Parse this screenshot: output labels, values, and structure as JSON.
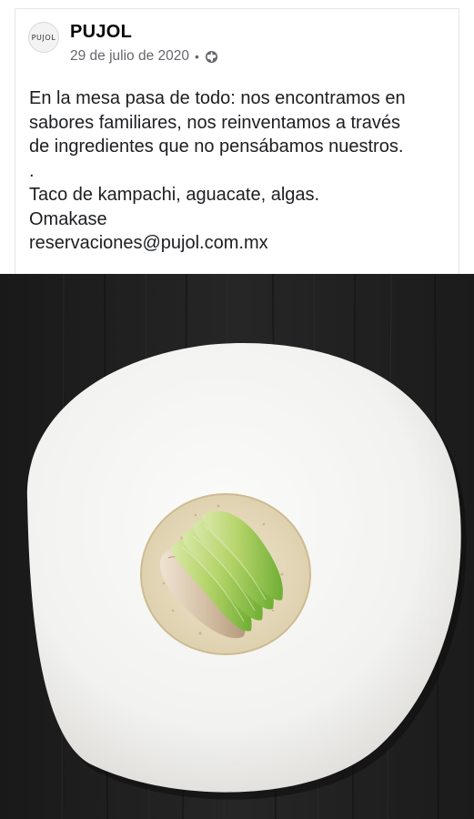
{
  "post": {
    "avatar_text": "PUJOL",
    "page_name": "PUJOL",
    "date": "29 de julio de 2020",
    "separator": "•",
    "privacy_icon": "globe-icon",
    "text_lines": [
      "En la mesa pasa de todo: nos encontramos en",
      "sabores familiares, nos reinventamos a través",
      "de ingredientes que no pensábamos nuestros.",
      ".",
      "Taco de kampachi, aguacate, algas.",
      "Omakase",
      "reservaciones@pujol.com.mx"
    ]
  },
  "colors": {
    "name_text": "#050505",
    "meta_text": "#65676b",
    "body_text": "#1c1e21",
    "table_wood": "#1f1f1f",
    "plate": "#f4f4f2",
    "avocado": "#8fc04a"
  }
}
